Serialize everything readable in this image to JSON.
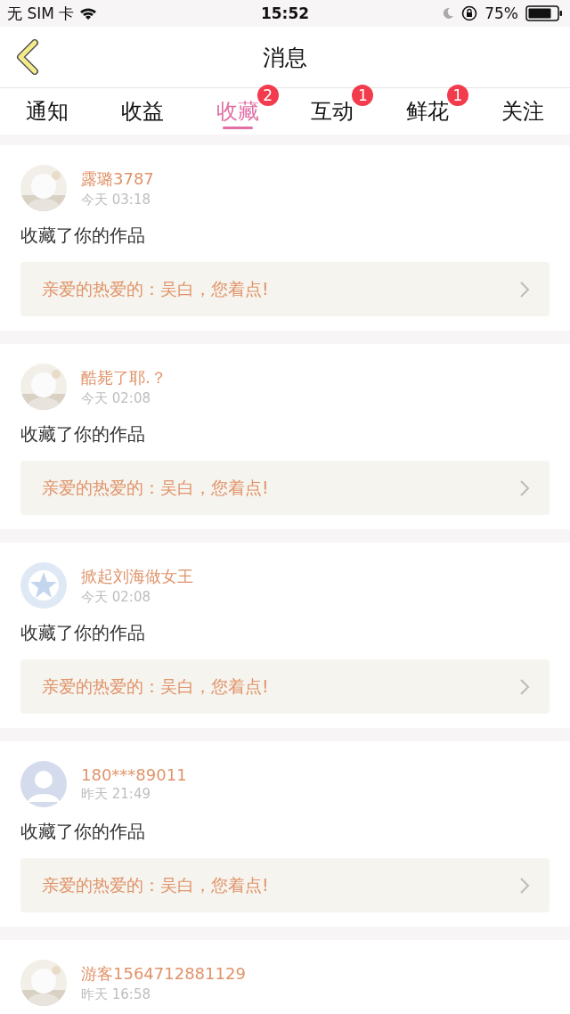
{
  "status_bar": {
    "carrier": "无 SIM 卡",
    "time": "15:52",
    "battery": "75%"
  },
  "nav": {
    "title": "消息"
  },
  "tabs": [
    {
      "label": "通知",
      "selected": false
    },
    {
      "label": "收益",
      "selected": false
    },
    {
      "label": "收藏",
      "selected": true,
      "badge": "2"
    },
    {
      "label": "互动",
      "selected": false,
      "badge": "1"
    },
    {
      "label": "鲜花",
      "selected": false,
      "badge": "1"
    },
    {
      "label": "关注",
      "selected": false
    }
  ],
  "messages": [
    {
      "name": "露璐3787",
      "time": "今天 03:18",
      "text": "收藏了你的作品",
      "quote": "亲爱的热爱的：吴白，您着点!"
    },
    {
      "name": "酷毙了耶.？",
      "time": "今天 02:08",
      "text": "收藏了你的作品",
      "quote": "亲爱的热爱的：吴白，您着点!"
    },
    {
      "avatar": {
        "kind": "star"
      },
      "name": "掀起刘海做女王",
      "time": "今天 02:08",
      "text": "收藏了你的作品",
      "quote": "亲爱的热爱的：吴白，您着点!"
    },
    {
      "avatar": {
        "kind": "silhouette"
      },
      "name": "180***89011",
      "time": "昨天 21:49",
      "text": "收藏了你的作品",
      "quote": "亲爱的热爱的：吴白，您着点!"
    },
    {
      "name": "游客1564712881129",
      "time": "昨天 16:58"
    }
  ]
}
